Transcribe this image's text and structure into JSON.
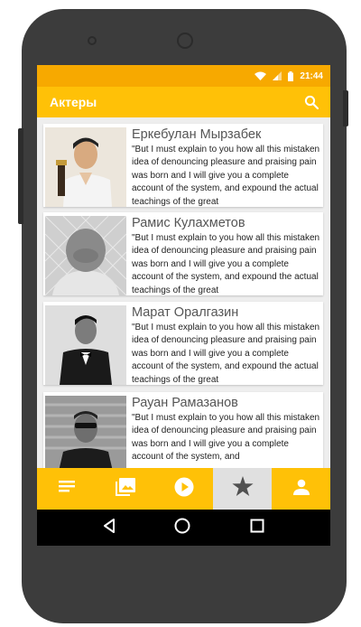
{
  "status": {
    "time": "21:44"
  },
  "appbar": {
    "title": "Актеры",
    "search_icon": "search-icon"
  },
  "actors": [
    {
      "name": "Еркебулан Мырзабек",
      "description": "\"But I must explain to you how all this mistaken idea of denouncing pleasure and praising pain was born and I will give you a complete account of the system, and expound the actual teachings of the great"
    },
    {
      "name": "Рамис Кулахметов",
      "description": "\"But I must explain to you how all this mistaken idea of denouncing pleasure and praising pain was born and I will give you a complete account of the system, and expound the actual teachings of the great"
    },
    {
      "name": "Марат Оралгазин",
      "description": "\"But I must explain to you how all this mistaken idea of denouncing pleasure and praising pain was born and I will give you a complete account of the system, and expound the actual teachings of the great"
    },
    {
      "name": "Рауан Рамазанов",
      "description": "\"But I must explain to you how all this mistaken idea of denouncing pleasure and praising pain was born and I will give you a complete account of the system, and"
    }
  ],
  "bottom_nav": [
    {
      "icon": "list-icon",
      "active": false
    },
    {
      "icon": "photo-icon",
      "active": false
    },
    {
      "icon": "play-icon",
      "active": false
    },
    {
      "icon": "star-icon",
      "active": true
    },
    {
      "icon": "person-icon",
      "active": false
    }
  ],
  "colors": {
    "accent": "#ffc107",
    "statusbar": "#f7a900",
    "active_tab": "#e0e0e0"
  }
}
